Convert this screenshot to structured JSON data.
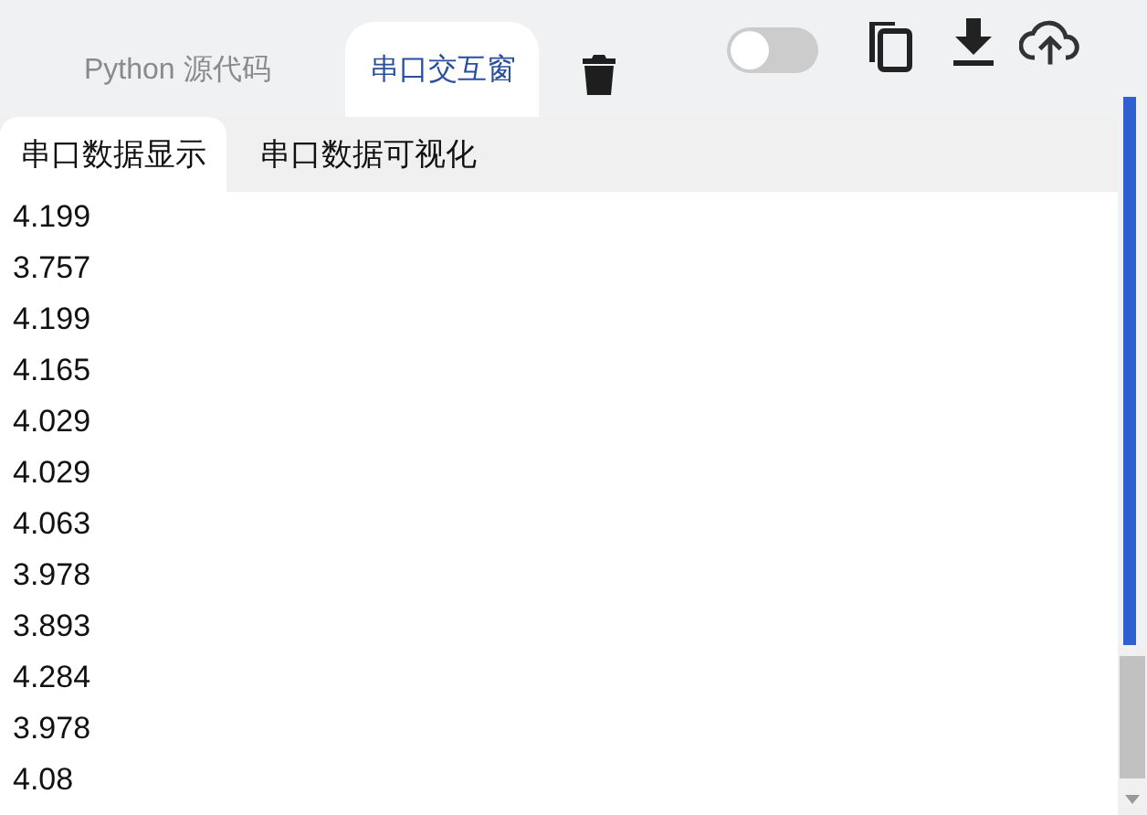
{
  "tabs": [
    {
      "label": "Python 源代码",
      "selected": false
    },
    {
      "label": "串口交互窗",
      "selected": true
    }
  ],
  "toggle": {
    "on": false
  },
  "subtabs": [
    {
      "label": "串口数据显示",
      "selected": true
    },
    {
      "label": "串口数据可视化",
      "selected": false
    }
  ],
  "lines": [
    "4.199",
    "3.757",
    "4.199",
    "4.165",
    "4.029",
    "4.029",
    "4.063",
    "3.978",
    "3.893",
    "4.284",
    "3.978",
    "4.08"
  ]
}
